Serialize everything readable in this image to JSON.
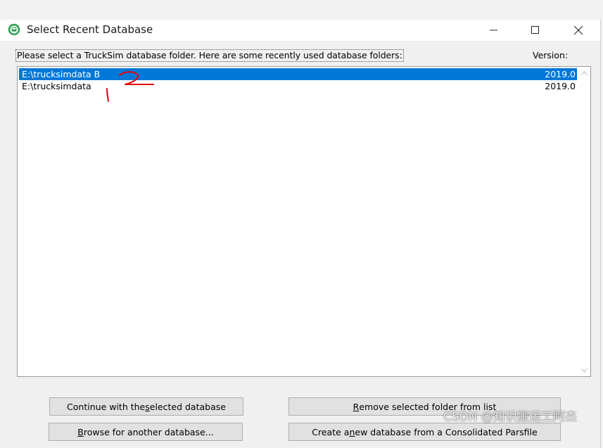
{
  "window": {
    "title": "Select Recent Database",
    "icon": "trucksim-app-icon"
  },
  "dialog": {
    "prompt": "Please select a TruckSim database folder. Here are some recently used database folders:",
    "version_label": "Version:"
  },
  "databases": [
    {
      "path": "E:\\trucksimdata B",
      "version": "2019.0",
      "selected": true
    },
    {
      "path": "E:\\trucksimdata",
      "version": "2019.0",
      "selected": false
    }
  ],
  "buttons": {
    "continue": {
      "pre": "Continue with the ",
      "key": "s",
      "post": "elected database"
    },
    "remove": {
      "pre": "",
      "key": "R",
      "post": "emove selected folder from list"
    },
    "browse": {
      "pre": "",
      "key": "B",
      "post": "rowse for another database..."
    },
    "create": {
      "pre": "Create a ",
      "key": "n",
      "post": "ew database from a Consolidated Parsfile"
    }
  },
  "watermark": "CSDN @知识搬运工阿杰",
  "colors": {
    "selection": "#0078d7",
    "annotation": "#e8000b"
  }
}
